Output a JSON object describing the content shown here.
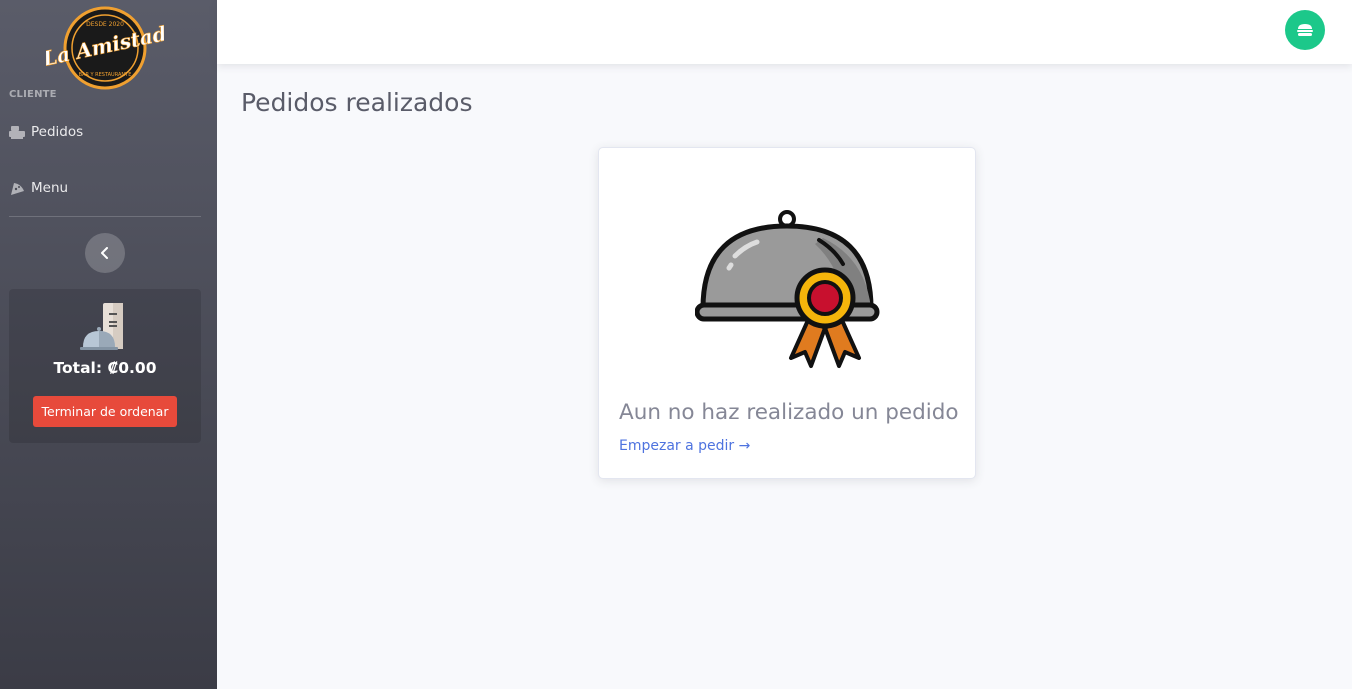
{
  "brand": {
    "name": "La Amistad",
    "tagline_top": "DESDE 2020",
    "tagline_bottom": "BAR Y RESTAURANTE"
  },
  "sidebar": {
    "heading": "CLIENTE",
    "items": [
      {
        "label": "Pedidos",
        "icon": "cash-register-icon"
      },
      {
        "label": "Menu",
        "icon": "pizza-slice-icon"
      }
    ],
    "toggle_icon": "chevron-left-icon"
  },
  "cart": {
    "icon": "cloche-receipt-icon",
    "total": "Total: ₡0.00",
    "checkout_label": "Terminar de ordenar"
  },
  "topbar": {
    "user_icon": "burger-icon"
  },
  "main": {
    "title": "Pedidos realizados",
    "empty_message": "Aun no haz realizado un pedido",
    "start_link": "Empezar a pedir →",
    "illustration": "cloche-award-icon"
  },
  "colors": {
    "sidebar_top": "#5a5c69",
    "sidebar_bottom": "#3b3c46",
    "danger": "#e74a3b",
    "success": "#1cc88a",
    "primary": "#4e73df",
    "muted": "#858796"
  }
}
